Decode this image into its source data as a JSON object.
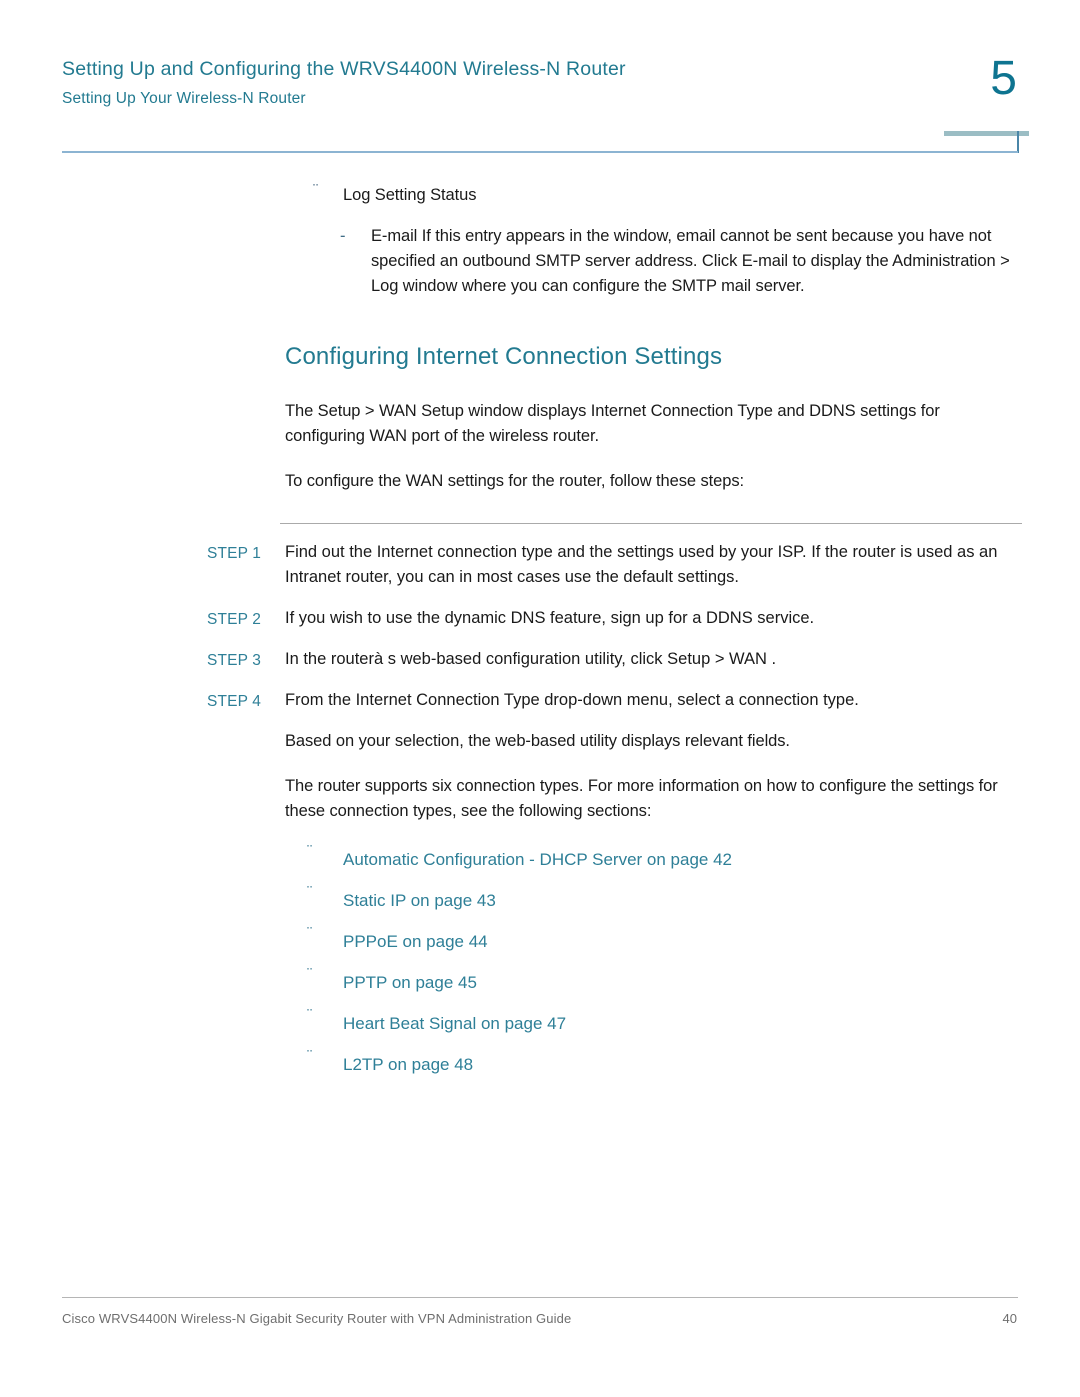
{
  "header": {
    "title": "Setting Up and Configuring the WRVS4400N Wireless-N Router",
    "subtitle": "Setting Up Your Wireless-N Router",
    "chapter_number": "5"
  },
  "colors": {
    "accent_teal": "#227A90",
    "step_teal": "#2E7F97",
    "rule_blue": "#8CB4D2",
    "rule_gray": "#AAAAAA",
    "body_text": "#1A1A1A",
    "footer_gray": "#6E6E6E"
  },
  "icons": {
    "bullet": "¨",
    "dash": "-"
  },
  "top_list": {
    "item_label": "Log Setting Status",
    "sub_item": "E-mail If this entry appears in the window, email cannot be sent because you have not specified an outbound SMTP server address. Click E-mail  to display the Administration > Log window where you can configure the SMTP mail server."
  },
  "section": {
    "heading": "Configuring Internet Connection Settings",
    "intro_paragraph": "The Setup > WAN Setup window displays Internet Connection Type and DDNS settings for configuring WAN port of the wireless router.",
    "lead_in": "To configure the WAN settings for the router, follow these steps:"
  },
  "steps": [
    {
      "label": "STEP 1",
      "text": "Find out the Internet connection type and the settings used by your ISP. If the router is used as an Intranet router, you can in most cases use the default settings."
    },
    {
      "label": "STEP 2",
      "text": "If you wish to use the dynamic DNS feature, sign up for a DDNS service."
    },
    {
      "label": "STEP 3",
      "text": "In the routerà s web-based configuration utility, click Setup > WAN ."
    },
    {
      "label": "STEP 4",
      "text": "From the Internet Connection Type drop-down menu, select a connection type."
    }
  ],
  "after_steps": {
    "paragraph_1": "Based on your selection, the web-based utility displays relevant fields.",
    "paragraph_2": "The router supports six connection types. For more information on how to configure the settings for these connection types, see the following sections:"
  },
  "cross_references": [
    {
      "label": "Automatic Configuration - DHCP Server on page 42"
    },
    {
      "label": "Static IP on page 43"
    },
    {
      "label": "PPPoE on page 44"
    },
    {
      "label": "PPTP on page 45"
    },
    {
      "label": "Heart Beat Signal on page 47"
    },
    {
      "label": "L2TP on page 48"
    }
  ],
  "footer": {
    "text": "Cisco WRVS4400N Wireless-N Gigabit Security Router with VPN Administration Guide",
    "page_number": "40"
  }
}
